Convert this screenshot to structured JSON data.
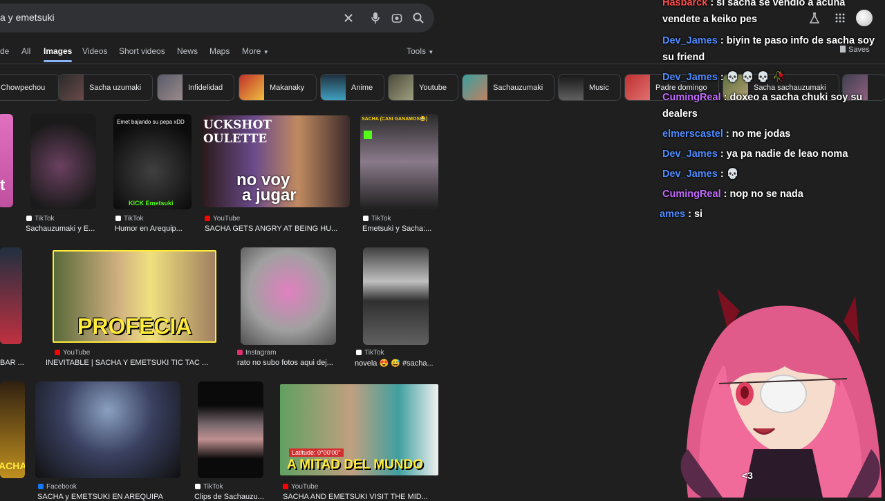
{
  "search": {
    "query": "a y emetsuki"
  },
  "tabs": [
    "de",
    "All",
    "Images",
    "Videos",
    "Short videos",
    "News",
    "Maps",
    "More",
    "Tools"
  ],
  "chips": [
    "Chowpechou",
    "Sacha uzumaki",
    "Infidelidad",
    "Makanaky",
    "Anime",
    "Youtube",
    "Sachauzumaki",
    "Music",
    "Padre domingo",
    "Sacha sachauzumaki"
  ],
  "header": {
    "saves": "Saves"
  },
  "results": [
    {
      "source": "TikTok",
      "title": "Sachauzumaki y E..."
    },
    {
      "source": "TikTok",
      "title": "Humor en Arequip..."
    },
    {
      "source": "YouTube",
      "title": "SACHA GETS ANGRY AT BEING HU..."
    },
    {
      "source": "TikTok",
      "title": "Emetsuki y Sacha:..."
    },
    {
      "source": "YouTube",
      "title": "INEVITABLE | SACHA Y EMETSUKI TIC TAC ..."
    },
    {
      "source": "Instagram",
      "title": "rato no subo fotos aqui dej..."
    },
    {
      "source": "TikTok",
      "title": "novela 😍 😅 #sacha..."
    },
    {
      "source": "Facebook",
      "title": "SACHA y EMETSUKI EN AREQUIPA"
    },
    {
      "source": "TikTok",
      "title": "Clips de Sachauzu..."
    },
    {
      "source": "YouTube",
      "title": "SACHA AND EMETSUKI VISIT THE MID..."
    }
  ],
  "partial": {
    "left1": "t",
    "left2": "BAR ...",
    "left3": "ACHA"
  },
  "thumb_text": {
    "t2": "Emet bajando su pepa xDD",
    "t2b": "KICK Emetsuki",
    "t3a": "UCKSHOT",
    "t3b": "OULETTE",
    "t3c": "no voy",
    "t3d": "a jugar",
    "t4": "SACHA (CASI GANAMOS😂)",
    "t5": "PROFECIA",
    "t10a": "Latitude: 0°00'00\"",
    "t10b": "A MITAD DEL MUNDO"
  },
  "chat": [
    {
      "user": "Hasbarck",
      "color": "#ff4d4d",
      "text": ": si sacha se vendio a acuña vendete a keiko pes"
    },
    {
      "user": "Dev_James",
      "color": "#4f8cff",
      "text": ": biyin te paso info de sacha soy su friend"
    },
    {
      "user": "Dev_James",
      "color": "#4f8cff",
      "text": ": 💀 💀 💀 🥀"
    },
    {
      "user": "CumingReal",
      "color": "#c36bff",
      "text": ": doxeo a sacha chuki soy su dealers"
    },
    {
      "user": "elmerscastel",
      "color": "#4f8cff",
      "text": ": no me jodas"
    },
    {
      "user": "Dev_James",
      "color": "#4f8cff",
      "text": ": ya pa nadie de leao noma"
    },
    {
      "user": "Dev_James",
      "color": "#4f8cff",
      "text": ": 💀"
    },
    {
      "user": "CumingReal",
      "color": "#c36bff",
      "text": ": nop no se nada"
    },
    {
      "user": "ames",
      "color": "#4f8cff",
      "text": ": si"
    }
  ],
  "avatar": {
    "caption": "<3"
  }
}
